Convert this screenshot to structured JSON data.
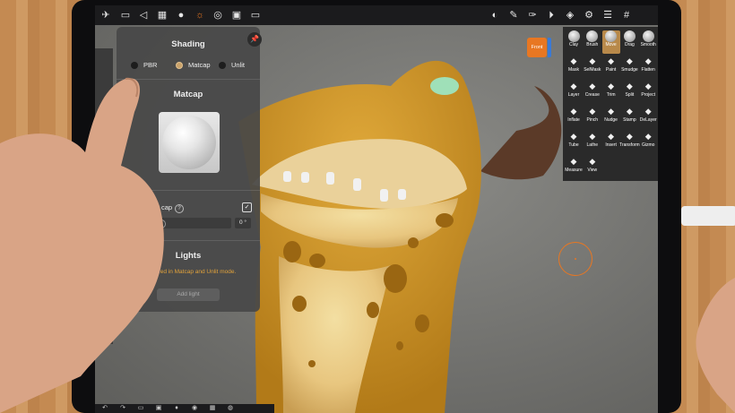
{
  "topbar_icons": [
    "menu-icon",
    "folder-icon",
    "share-icon",
    "grid-icon",
    "sphere-icon",
    "sun-icon",
    "target-icon",
    "image-icon",
    "video-icon"
  ],
  "topbar_right_icons": [
    "material-icon",
    "brush-icon",
    "paint-icon",
    "mirror-icon",
    "layers-icon",
    "settings-icon",
    "sliders-icon",
    "hash-icon"
  ],
  "shading": {
    "title": "Shading",
    "options": [
      {
        "label": "PBR",
        "selected": false
      },
      {
        "label": "Matcap",
        "selected": true
      },
      {
        "label": "Unlit",
        "selected": false
      }
    ]
  },
  "matcap": {
    "title": "Matcap",
    "row_label": "cap",
    "slider_value": "0 °"
  },
  "lights": {
    "title": "Lights",
    "warning": "re ignored in Matcap and Unlit mode.",
    "add_label": "Add light"
  },
  "front_label": "Front",
  "tools": [
    {
      "label": "Clay",
      "icon": "clay-icon"
    },
    {
      "label": "Brush",
      "icon": "brush-tool-icon"
    },
    {
      "label": "Move",
      "icon": "move-icon",
      "active": true
    },
    {
      "label": "Drag",
      "icon": "drag-icon"
    },
    {
      "label": "Smooth",
      "icon": "smooth-icon"
    },
    {
      "label": "Mask",
      "icon": "mask-icon"
    },
    {
      "label": "SelMask",
      "icon": "selmask-icon"
    },
    {
      "label": "Paint",
      "icon": "paint-tool-icon"
    },
    {
      "label": "Smudge",
      "icon": "smudge-icon"
    },
    {
      "label": "Flatten",
      "icon": "flatten-icon"
    },
    {
      "label": "Layer",
      "icon": "layer-icon"
    },
    {
      "label": "Crease",
      "icon": "crease-icon"
    },
    {
      "label": "Trim",
      "icon": "trim-icon"
    },
    {
      "label": "Split",
      "icon": "split-icon"
    },
    {
      "label": "Project",
      "icon": "project-icon"
    },
    {
      "label": "Inflate",
      "icon": "inflate-icon"
    },
    {
      "label": "Pinch",
      "icon": "pinch-icon"
    },
    {
      "label": "Nudge",
      "icon": "nudge-icon"
    },
    {
      "label": "Stamp",
      "icon": "stamp-icon"
    },
    {
      "label": "DeLayer",
      "icon": "delayer-icon"
    },
    {
      "label": "Tube",
      "icon": "tube-icon"
    },
    {
      "label": "Lathe",
      "icon": "lathe-icon"
    },
    {
      "label": "Insert",
      "icon": "insert-icon"
    },
    {
      "label": "Transform",
      "icon": "transform-icon"
    },
    {
      "label": "Gizmo",
      "icon": "gizmo-icon"
    },
    {
      "label": "Measure",
      "icon": "measure-icon"
    },
    {
      "label": "View",
      "icon": "view-icon"
    }
  ],
  "colors": {
    "accent": "#e87722",
    "panel": "#484848",
    "model": "#d4a02c",
    "spots": "#9a6612"
  }
}
